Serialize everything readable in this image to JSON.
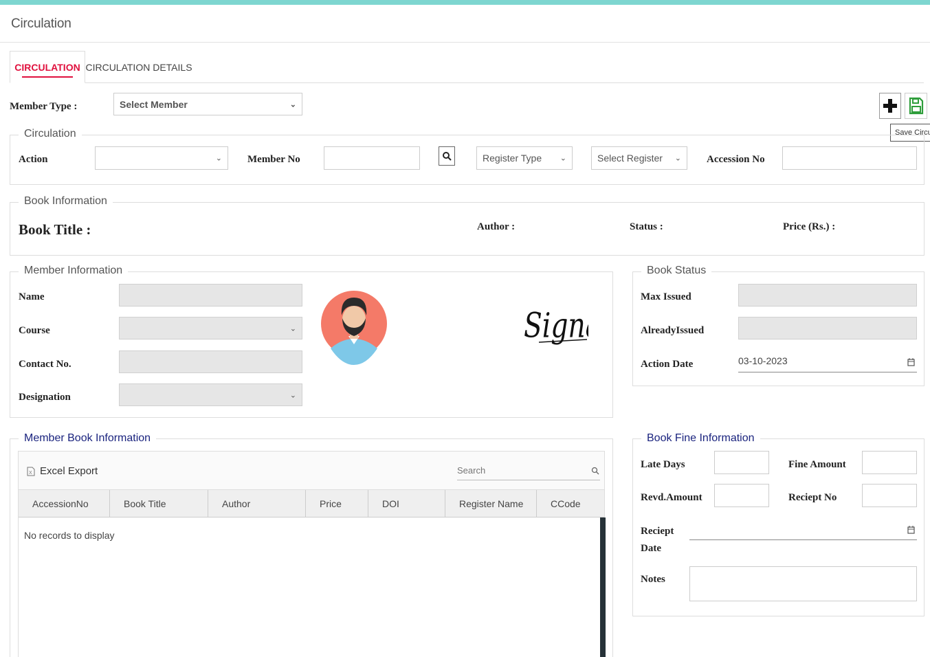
{
  "page": {
    "title": "Circulation"
  },
  "tabs": [
    {
      "label": "CIRCULATION",
      "active": true
    },
    {
      "label": "CIRCULATION DETAILS",
      "active": false
    }
  ],
  "header": {
    "member_type_label": "Member Type :",
    "member_select": "Select Member",
    "add_icon": "plus-icon",
    "save_icon": "save-icon",
    "save_tooltip": "Save Circulation"
  },
  "circulation": {
    "legend": "Circulation",
    "action_label": "Action",
    "action_value": "",
    "member_no_label": "Member No",
    "member_no_value": "",
    "search_icon": "search-icon",
    "register_type": "Register Type",
    "select_register": "Select Register",
    "accession_no_label": "Accession No",
    "accession_no_value": ""
  },
  "book_info": {
    "legend": "Book Information",
    "book_title_label": "Book Title :",
    "author_label": "Author :",
    "status_label": "Status :",
    "price_label": "Price (Rs.) :"
  },
  "member_info": {
    "legend": "Member Information",
    "name_label": "Name",
    "course_label": "Course",
    "contact_label": "Contact No.",
    "designation_label": "Designation",
    "signature_text": "Signature."
  },
  "book_status": {
    "legend": "Book Status",
    "max_issued_label": "Max Issued",
    "already_issued_label": "AlreadyIssued",
    "action_date_label": "Action Date",
    "action_date_value": "03-10-2023",
    "calendar_icon": "calendar-icon"
  },
  "member_book_info": {
    "legend": "Member Book Information",
    "excel_export": "Excel Export",
    "search_placeholder": "Search",
    "columns": [
      "AccessionNo",
      "Book Title",
      "Author",
      "Price",
      "DOI",
      "Register Name",
      "CCode"
    ],
    "empty_text": "No records to display"
  },
  "fine_info": {
    "legend": "Book Fine Information",
    "late_days_label": "Late Days",
    "fine_amount_label": "Fine Amount",
    "revd_amount_label": "Revd.Amount",
    "reciept_no_label": "Reciept No",
    "reciept_date_label_1": "Reciept",
    "reciept_date_label_2": "Date",
    "notes_label": "Notes"
  },
  "colors": {
    "accent": "#e0103d",
    "topbar": "#7ed6d0",
    "legend_blue": "#1a237e",
    "save_green": "#2e9d3a"
  }
}
